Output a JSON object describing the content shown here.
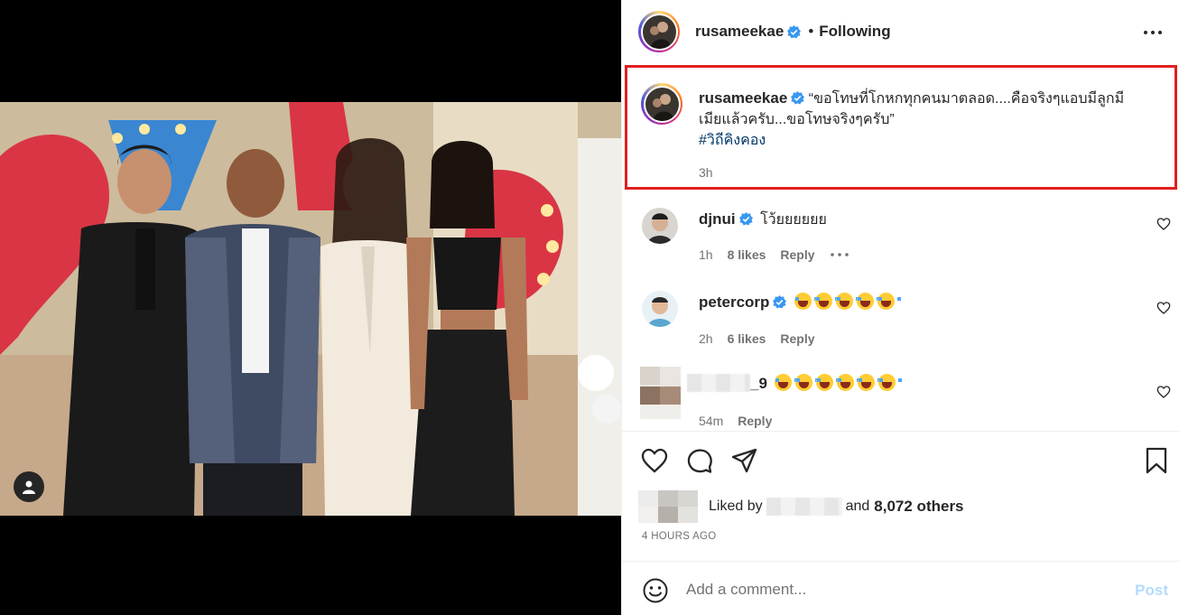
{
  "header": {
    "username": "rusameekae",
    "separator": "•",
    "follow_state": "Following"
  },
  "caption": {
    "username": "rusameekae",
    "text_line1": "“ขอโทษที่โกหกทุกคนมาตลอด....คือจริงๆแอบมีลูกมี",
    "text_line2": "เมียแล้วครับ...ขอโทษจริงๆครับ”",
    "hashtag": "#วิถีคิงคอง",
    "time": "3h"
  },
  "comments": [
    {
      "username": "djnui",
      "text": "โว้ยยยยยย",
      "time": "1h",
      "likes": "8 likes",
      "reply": "Reply",
      "emoji_count": 0
    },
    {
      "username": "petercorp",
      "text": "",
      "time": "2h",
      "likes": "6 likes",
      "reply": "Reply",
      "emoji_count": 5
    },
    {
      "username": "_9",
      "text": "",
      "time": "54m",
      "likes": "",
      "reply": "Reply",
      "emoji_count": 6
    }
  ],
  "likes_summary": {
    "prefix": "Liked by",
    "and": "and",
    "others": "8,072 others"
  },
  "time_ago": "4 HOURS AGO",
  "comment_box": {
    "placeholder": "Add a comment...",
    "post_label": "Post"
  },
  "colors": {
    "highlight_border": "#e0201e",
    "verified_blue": "#3897f0",
    "hashtag": "#00376b",
    "post_disabled": "#b3dbff"
  },
  "icons": {
    "more": "more-horizontal-icon",
    "verified": "verified-badge-icon",
    "like": "heart-icon",
    "comment": "comment-icon",
    "share": "paper-plane-icon",
    "save": "bookmark-icon",
    "emoji": "emoji-smile-icon",
    "user_tag": "user-tag-icon"
  }
}
